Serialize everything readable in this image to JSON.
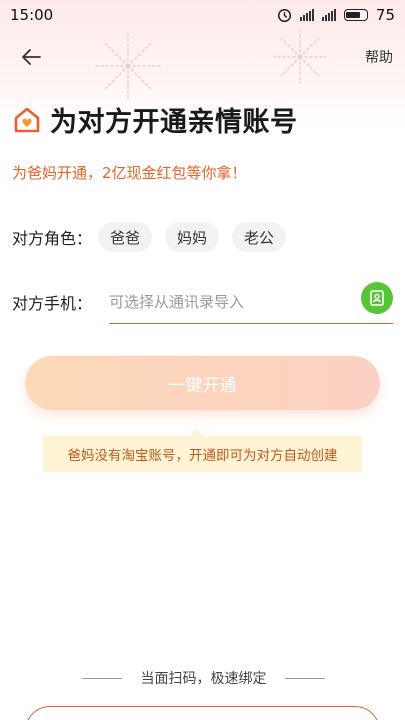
{
  "status_bar": {
    "time": "15:00",
    "battery": "75",
    "icons": [
      "alarm-icon",
      "signal-icon",
      "signal-icon",
      "battery-icon"
    ]
  },
  "nav": {
    "back_icon": "back-arrow-icon",
    "help_label": "帮助"
  },
  "header": {
    "icon": "house-heart-icon",
    "title": "为对方开通亲情账号",
    "promo": "为爸妈开通，2亿现金红包等你拿！"
  },
  "role": {
    "label": "对方角色：",
    "options": [
      "爸爸",
      "妈妈",
      "老公"
    ]
  },
  "phone": {
    "label": "对方手机：",
    "placeholder": "可选择从通讯录导入",
    "value": "",
    "contact_icon": "contacts-icon"
  },
  "action": {
    "open_label": "一键开通",
    "tip": "爸妈没有淘宝账号，开通即可为对方自动创建"
  },
  "footer": {
    "divider_text": "当面扫码，极速绑定"
  },
  "colors": {
    "accent": "#e8622a",
    "button_start": "#fcd9b8",
    "button_end": "#fcd0c2",
    "tip_bg": "#fff3d6",
    "contact_green": "#58c43a"
  }
}
